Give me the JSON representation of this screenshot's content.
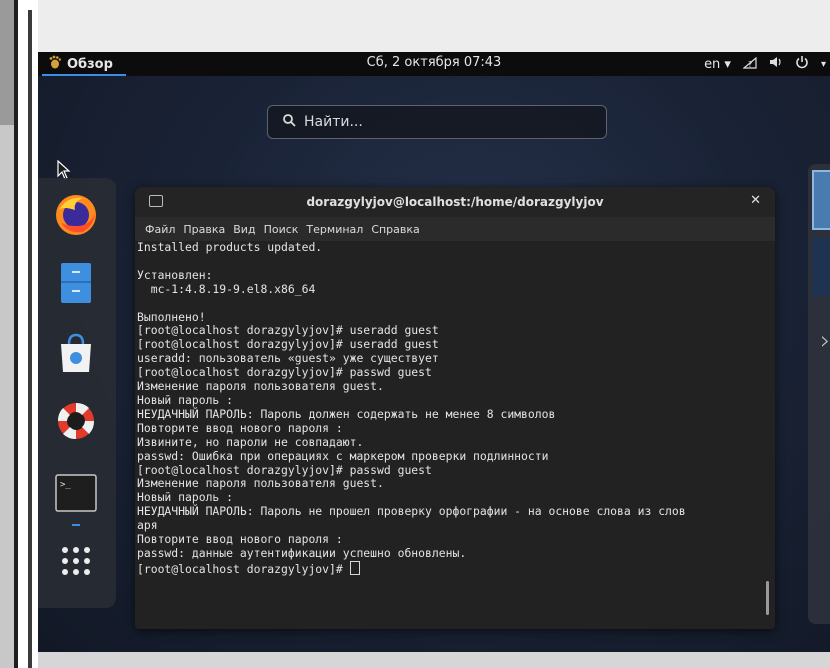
{
  "topbar": {
    "activities_label": "Обзор",
    "clock": "Сб, 2 октября  07:43",
    "lang": "en ▾"
  },
  "search": {
    "placeholder": "Найти..."
  },
  "dock": {
    "items": [
      "firefox-icon",
      "files-icon",
      "software-icon",
      "help-icon",
      "terminal-icon",
      "app-grid-icon"
    ]
  },
  "terminal": {
    "title": "dorazgylyjov@localhost:/home/dorazgylyjov",
    "menu": [
      "Файл",
      "Правка",
      "Вид",
      "Поиск",
      "Терминал",
      "Справка"
    ],
    "lines": [
      "Installed products updated.",
      "",
      "Установлен:",
      "  mc-1:4.8.19-9.el8.x86_64",
      "",
      "Выполнено!",
      "[root@localhost dorazgylyjov]# useradd guest",
      "[root@localhost dorazgylyjov]# useradd guest",
      "useradd: пользователь «guest» уже существует",
      "[root@localhost dorazgylyjov]# passwd guest",
      "Изменение пароля пользователя guest.",
      "Новый пароль :",
      "НЕУДАЧНЫЙ ПАРОЛЬ: Пароль должен содержать не менее 8 символов",
      "Повторите ввод нового пароля :",
      "Извините, но пароли не совпадают.",
      "passwd: Ошибка при операциях с маркером проверки подлинности",
      "[root@localhost dorazgylyjov]# passwd guest",
      "Изменение пароля пользователя guest.",
      "Новый пароль :",
      "НЕУДАЧНЫЙ ПАРОЛЬ: Пароль не прошел проверку орфографии - на основе слова из слов",
      "аря",
      "Повторите ввод нового пароля :",
      "passwd: данные аутентификации успешно обновлены.",
      "[root@localhost dorazgylyjov]# "
    ]
  },
  "colors": {
    "accent": "#3a8ee6",
    "terminal_bg": "#222222",
    "terminal_text": "#e4e4e4"
  }
}
